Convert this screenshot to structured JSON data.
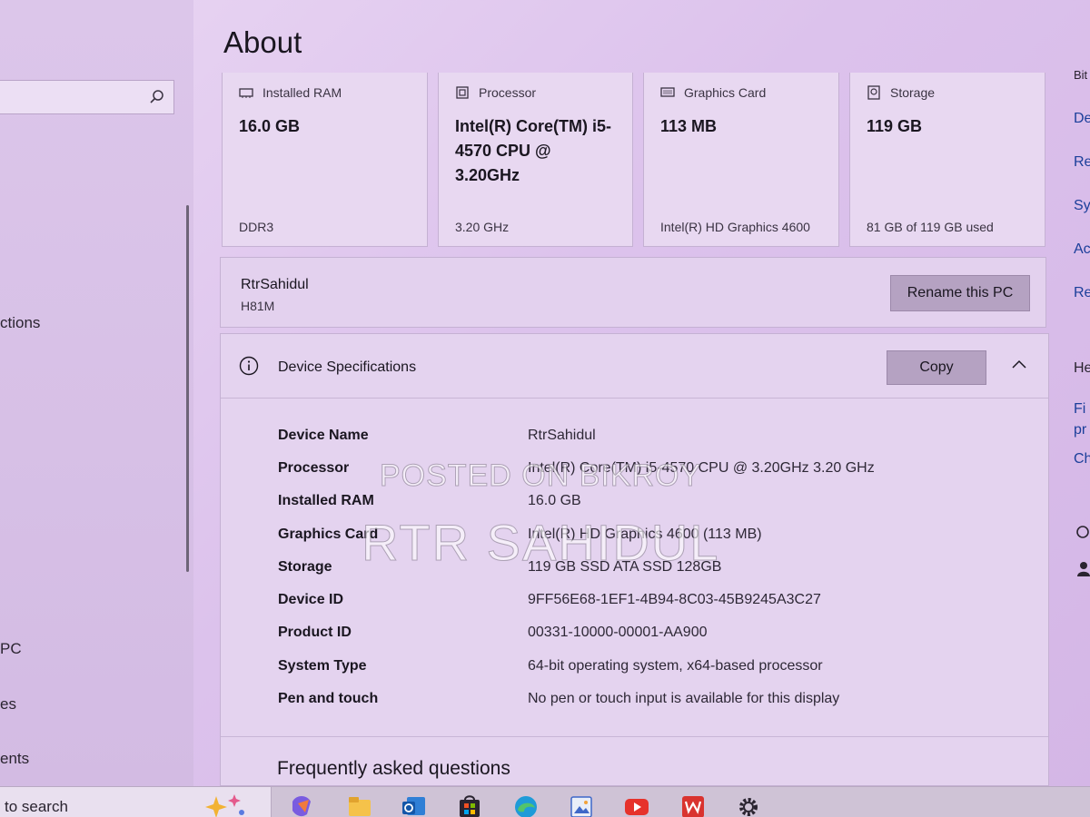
{
  "page": {
    "title": "About"
  },
  "left_nav": {
    "fragments": [
      "ctions",
      "PC",
      "es",
      "ents"
    ]
  },
  "right_panel": {
    "fragments": [
      "Bit",
      "De",
      "Re",
      "Sys",
      "Ac",
      "Re",
      "He",
      "Fi",
      "pr",
      "Ch"
    ]
  },
  "cards": [
    {
      "label": "Installed RAM",
      "icon": "ram-icon",
      "value": "16.0 GB",
      "sub": "DDR3"
    },
    {
      "label": "Processor",
      "icon": "processor-icon",
      "value": "Intel(R) Core(TM) i5-4570 CPU @ 3.20GHz",
      "sub": "3.20 GHz"
    },
    {
      "label": "Graphics Card",
      "icon": "graphics-card-icon",
      "value": "113 MB",
      "sub": "Intel(R) HD Graphics 4600"
    },
    {
      "label": "Storage",
      "icon": "storage-icon",
      "value": "119 GB",
      "sub": "81 GB of 119 GB used"
    }
  ],
  "device": {
    "name": "RtrSahidul",
    "model": "H81M",
    "rename_label": "Rename this PC"
  },
  "specs": {
    "title": "Device Specifications",
    "copy_label": "Copy",
    "rows": [
      {
        "label": "Device Name",
        "value": "RtrSahidul"
      },
      {
        "label": "Processor",
        "value": "Intel(R) Core(TM) i5-4570 CPU @ 3.20GHz   3.20 GHz"
      },
      {
        "label": "Installed RAM",
        "value": "16.0 GB"
      },
      {
        "label": "Graphics Card",
        "value": "Intel(R) HD Graphics 4600 (113 MB)"
      },
      {
        "label": "Storage",
        "value": "119 GB SSD ATA SSD 128GB"
      },
      {
        "label": "Device ID",
        "value": "9FF56E68-1EF1-4B94-8C03-45B9245A3C27"
      },
      {
        "label": "Product ID",
        "value": "00331-10000-00001-AA900"
      },
      {
        "label": "System Type",
        "value": "64-bit operating system, x64-based processor"
      },
      {
        "label": "Pen and touch",
        "value": "No pen or touch input is available for this display"
      }
    ]
  },
  "faq_title": "Frequently asked questions",
  "watermark": {
    "line1": "POSTED ON BIKROY",
    "line2": "RTR SAHIDUL"
  },
  "taskbar": {
    "search_text": "to search",
    "apps": [
      "copilot-app-icon",
      "file-explorer-icon",
      "outlook-icon",
      "microsoft-store-icon",
      "edge-icon",
      "photos-icon",
      "youtube-icon",
      "wps-office-icon",
      "settings-gear-icon"
    ]
  },
  "colors": {
    "background": "#dcc2ec",
    "button": "#b5a2c2",
    "link": "#1b3f9a"
  }
}
